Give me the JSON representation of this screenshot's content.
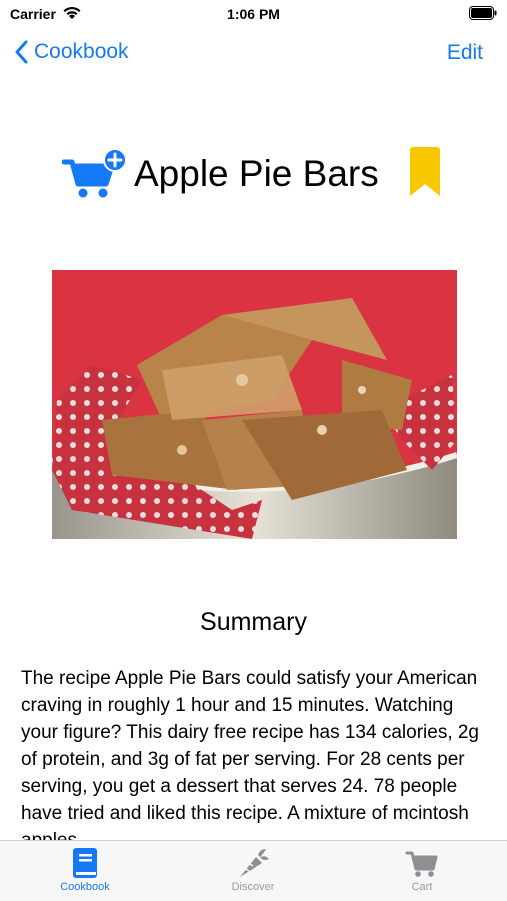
{
  "status": {
    "carrier": "Carrier",
    "time": "1:06 PM"
  },
  "nav": {
    "back_label": "Cookbook",
    "edit_label": "Edit"
  },
  "recipe": {
    "title": "Apple Pie Bars",
    "summary_heading": "Summary",
    "summary_text": "The recipe Apple Pie Bars could satisfy your American craving in roughly 1 hour and 15 minutes. Watching your figure? This dairy free recipe has 134 calories, 2g of protein, and 3g of fat per serving. For 28 cents per serving, you get a dessert that serves 24. 78 people have tried and liked this recipe. A mixture of mcintosh apples"
  },
  "tabs": [
    {
      "label": "Cookbook",
      "icon": "book-icon",
      "active": true
    },
    {
      "label": "Discover",
      "icon": "carrot-icon",
      "active": false
    },
    {
      "label": "Cart",
      "icon": "cart-icon",
      "active": false
    }
  ],
  "colors": {
    "accent": "#1479f6",
    "bookmark": "#f7c800",
    "photo_bg": "#d8303c"
  }
}
